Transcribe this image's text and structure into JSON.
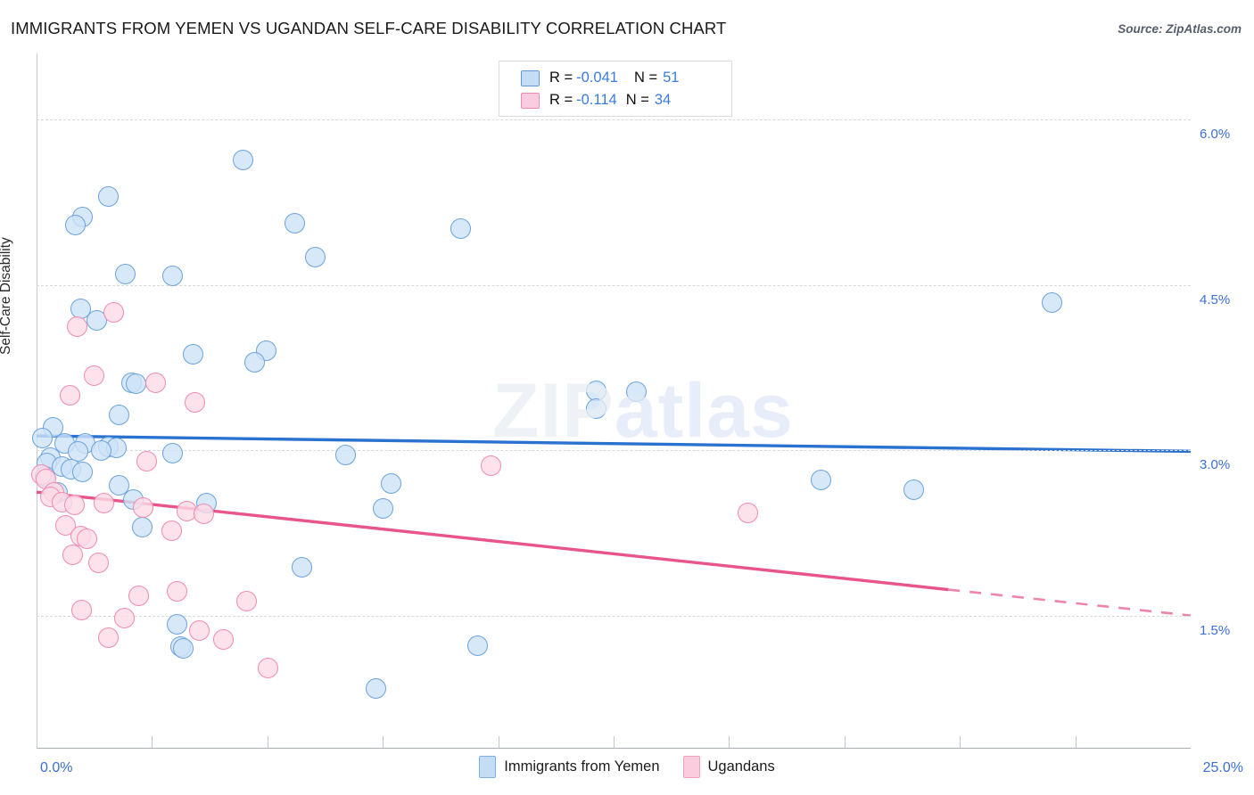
{
  "header": {
    "title": "IMMIGRANTS FROM YEMEN VS UGANDAN SELF-CARE DISABILITY CORRELATION CHART",
    "source": "Source: ZipAtlas.com"
  },
  "watermark": {
    "zip": "ZIP",
    "atlas": "atlas"
  },
  "stats_legend": {
    "rows": [
      {
        "r_label": "R =",
        "r_value": "-0.041",
        "n_label": "N =",
        "n_value": "51",
        "color": "#c5dcf5"
      },
      {
        "r_label": "R =",
        "r_value": "-0.114",
        "n_label": "N =",
        "n_value": "34",
        "color": "#fbccdd"
      }
    ]
  },
  "series_legend": [
    {
      "label": "Immigrants from Yemen",
      "color": "#c5dcf5"
    },
    {
      "label": "Ugandans",
      "color": "#fbccdd"
    }
  ],
  "chart_data": {
    "type": "scatter",
    "title": "IMMIGRANTS FROM YEMEN VS UGANDAN SELF-CARE DISABILITY CORRELATION CHART",
    "xlabel": "",
    "ylabel": "Self-Care Disability",
    "xlim": [
      0.0,
      25.0
    ],
    "ylim": [
      0.3,
      6.6
    ],
    "x_tick_labels": [
      "0.0%",
      "25.0%"
    ],
    "y_tick_labels": [
      "6.0%",
      "4.5%",
      "3.0%",
      "1.5%"
    ],
    "y_ticks": [
      6.0,
      4.5,
      3.0,
      1.5
    ],
    "grid": true,
    "legend_position": "bottom-center",
    "accent_colors": {
      "blue_fill": "#cde2f7",
      "blue_stroke": "#6ca3dd",
      "pink_fill": "#fcdbe6",
      "pink_stroke": "#f18ab1",
      "blue_line": "#2a72d0",
      "pink_line": "#e8558c",
      "tick_text": "#3b6fd4"
    },
    "series": [
      {
        "name": "Immigrants from Yemen",
        "r": -0.041,
        "n": 51,
        "color": "#cde2f7",
        "trend": {
          "x0": 0.0,
          "y0": 3.13,
          "x1": 25.0,
          "y1": 2.99,
          "dashed_from": null
        },
        "points": [
          [
            4.48,
            5.63
          ],
          [
            1.55,
            5.3
          ],
          [
            1.0,
            5.12
          ],
          [
            0.85,
            5.04
          ],
          [
            5.6,
            5.06
          ],
          [
            9.18,
            5.01
          ],
          [
            6.03,
            4.75
          ],
          [
            1.92,
            4.6
          ],
          [
            2.95,
            4.58
          ],
          [
            22.0,
            4.34
          ],
          [
            0.95,
            4.28
          ],
          [
            1.3,
            4.18
          ],
          [
            3.4,
            3.87
          ],
          [
            4.97,
            3.9
          ],
          [
            4.72,
            3.8
          ],
          [
            2.05,
            3.61
          ],
          [
            2.15,
            3.6
          ],
          [
            12.12,
            3.54
          ],
          [
            13.0,
            3.53
          ],
          [
            12.12,
            3.38
          ],
          [
            1.78,
            3.32
          ],
          [
            0.35,
            3.21
          ],
          [
            0.12,
            3.11
          ],
          [
            0.6,
            3.06
          ],
          [
            1.05,
            3.06
          ],
          [
            1.55,
            3.03
          ],
          [
            1.72,
            3.02
          ],
          [
            1.4,
            3.0
          ],
          [
            0.9,
            2.99
          ],
          [
            2.95,
            2.97
          ],
          [
            6.7,
            2.96
          ],
          [
            0.3,
            2.93
          ],
          [
            0.22,
            2.88
          ],
          [
            0.55,
            2.85
          ],
          [
            0.75,
            2.83
          ],
          [
            1.0,
            2.8
          ],
          [
            0.18,
            2.76
          ],
          [
            17.0,
            2.73
          ],
          [
            7.68,
            2.7
          ],
          [
            1.78,
            2.68
          ],
          [
            19.0,
            2.64
          ],
          [
            0.45,
            2.62
          ],
          [
            2.1,
            2.55
          ],
          [
            3.68,
            2.52
          ],
          [
            7.5,
            2.47
          ],
          [
            2.28,
            2.3
          ],
          [
            5.75,
            1.94
          ],
          [
            3.05,
            1.42
          ],
          [
            3.12,
            1.22
          ],
          [
            3.18,
            1.2
          ],
          [
            9.55,
            1.23
          ],
          [
            7.35,
            0.84
          ]
        ]
      },
      {
        "name": "Ugandans",
        "r": -0.114,
        "n": 34,
        "color": "#fcdbe6",
        "trend": {
          "x0": 0.0,
          "y0": 2.62,
          "x1": 25.0,
          "y1": 1.5,
          "dashed_from": 19.75
        },
        "points": [
          [
            1.68,
            4.25
          ],
          [
            0.88,
            4.12
          ],
          [
            1.25,
            3.68
          ],
          [
            0.72,
            3.5
          ],
          [
            2.58,
            3.61
          ],
          [
            3.42,
            3.43
          ],
          [
            9.85,
            2.86
          ],
          [
            2.38,
            2.9
          ],
          [
            0.1,
            2.78
          ],
          [
            0.2,
            2.74
          ],
          [
            0.38,
            2.62
          ],
          [
            0.3,
            2.58
          ],
          [
            0.55,
            2.53
          ],
          [
            0.82,
            2.5
          ],
          [
            1.45,
            2.52
          ],
          [
            2.3,
            2.48
          ],
          [
            3.25,
            2.45
          ],
          [
            3.62,
            2.42
          ],
          [
            15.4,
            2.43
          ],
          [
            0.62,
            2.32
          ],
          [
            0.95,
            2.22
          ],
          [
            1.1,
            2.2
          ],
          [
            2.92,
            2.27
          ],
          [
            0.78,
            2.05
          ],
          [
            1.35,
            1.98
          ],
          [
            3.05,
            1.72
          ],
          [
            2.22,
            1.68
          ],
          [
            4.55,
            1.63
          ],
          [
            0.98,
            1.55
          ],
          [
            1.9,
            1.48
          ],
          [
            3.52,
            1.36
          ],
          [
            1.55,
            1.3
          ],
          [
            4.05,
            1.28
          ],
          [
            5.02,
            1.02
          ]
        ]
      }
    ]
  }
}
